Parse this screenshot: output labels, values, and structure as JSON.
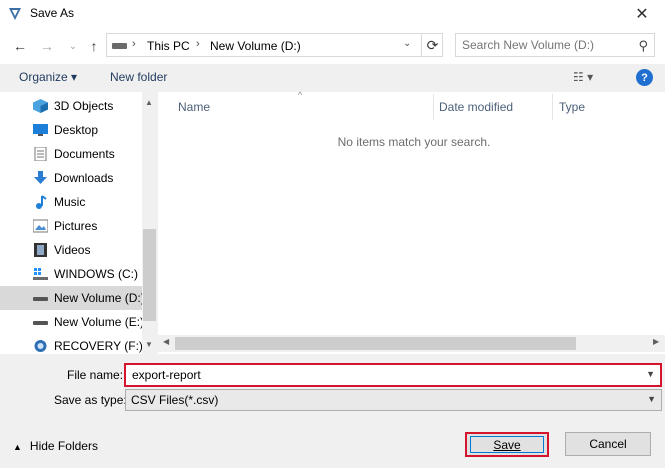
{
  "window": {
    "title": "Save As",
    "close_glyph": "✕"
  },
  "nav": {
    "back_glyph": "←",
    "forward_glyph": "→",
    "recent_glyph": "⌄",
    "up_glyph": "↑",
    "breadcrumb_sep": "›",
    "crumbs": [
      "This PC",
      "New Volume (D:)"
    ],
    "address_dropdown_glyph": "⌄",
    "refresh_glyph": "⟳",
    "search_placeholder": "Search New Volume (D:)",
    "search_glyph": "⚲"
  },
  "toolbar": {
    "organize_label": "Organize ▾",
    "new_folder_label": "New folder",
    "view_label": "☷ ▾",
    "help_label": "?"
  },
  "sidebar": {
    "items": [
      {
        "label": "3D Objects",
        "icon": "3d-objects-icon"
      },
      {
        "label": "Desktop",
        "icon": "desktop-icon"
      },
      {
        "label": "Documents",
        "icon": "documents-icon"
      },
      {
        "label": "Downloads",
        "icon": "downloads-icon"
      },
      {
        "label": "Music",
        "icon": "music-icon"
      },
      {
        "label": "Pictures",
        "icon": "pictures-icon"
      },
      {
        "label": "Videos",
        "icon": "videos-icon"
      },
      {
        "label": "WINDOWS (C:)",
        "icon": "windows-drive-icon"
      },
      {
        "label": "New Volume (D:)",
        "icon": "drive-icon",
        "selected": true
      },
      {
        "label": "New Volume (E:)",
        "icon": "drive-icon"
      },
      {
        "label": "RECOVERY (F:)",
        "icon": "recovery-drive-icon"
      }
    ]
  },
  "files": {
    "columns": [
      "Name",
      "Date modified",
      "Type"
    ],
    "empty_message": "No items match your search."
  },
  "form": {
    "file_name_label": "File name:",
    "file_name_value": "export-report",
    "save_type_label": "Save as type:",
    "save_type_value": "CSV Files(*.csv)"
  },
  "footer": {
    "hide_folders_label": "Hide Folders",
    "save_label": "Save",
    "cancel_label": "Cancel"
  },
  "colors": {
    "highlight": "#d4132c",
    "accent": "#0078d7",
    "help_blue": "#1f6fd1"
  }
}
